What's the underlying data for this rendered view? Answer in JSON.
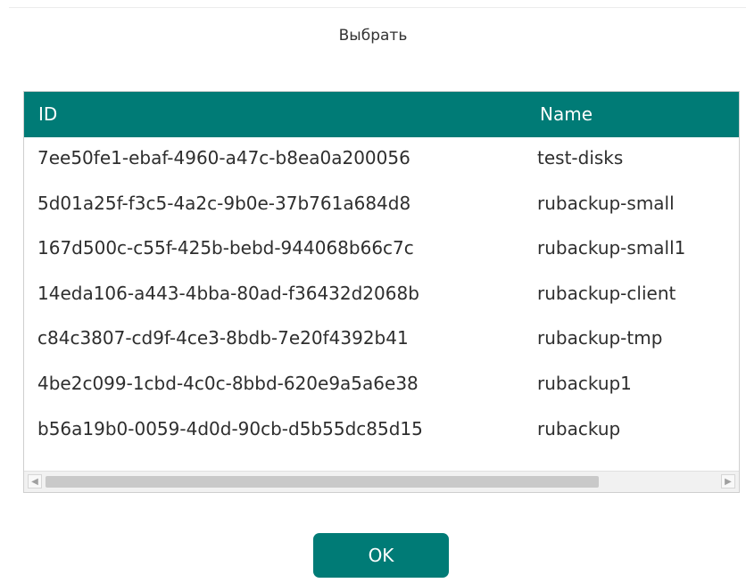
{
  "dialog": {
    "title": "Выбрать"
  },
  "table": {
    "columns": {
      "id": "ID",
      "name": "Name"
    },
    "rows": [
      {
        "id": "7ee50fe1-ebaf-4960-a47c-b8ea0a200056",
        "name": "test-disks"
      },
      {
        "id": "5d01a25f-f3c5-4a2c-9b0e-37b761a684d8",
        "name": "rubackup-small"
      },
      {
        "id": "167d500c-c55f-425b-bebd-944068b66c7c",
        "name": "rubackup-small1"
      },
      {
        "id": "14eda106-a443-4bba-80ad-f36432d2068b",
        "name": "rubackup-client"
      },
      {
        "id": "c84c3807-cd9f-4ce3-8bdb-7e20f4392b41",
        "name": "rubackup-tmp"
      },
      {
        "id": "4be2c099-1cbd-4c0c-8bbd-620e9a5a6e38",
        "name": "rubackup1"
      },
      {
        "id": "b56a19b0-0059-4d0d-90cb-d5b55dc85d15",
        "name": "rubackup"
      }
    ]
  },
  "scrollbar": {
    "left_icon": "arrow-left-icon",
    "right_icon": "arrow-right-icon"
  },
  "actions": {
    "ok_label": "OK"
  },
  "colors": {
    "accent": "#007b76",
    "header_text": "#ffffff",
    "body_text": "#2e2e2e"
  }
}
